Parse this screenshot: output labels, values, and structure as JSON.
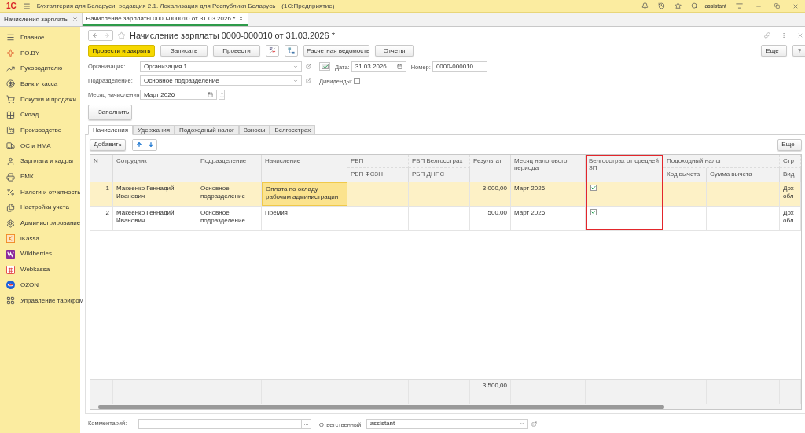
{
  "app": {
    "logo": "1С",
    "title": "Бухгалтерия для Беларуси, редакция 2.1. Локализация для Республики Беларусь",
    "platform": "(1С:Предприятие)",
    "user": "assistant"
  },
  "open_tabs": [
    {
      "label": "Начисления зарплаты",
      "selected": false
    },
    {
      "label": "Начисление зарплаты 0000-000010 от 31.03.2026 *",
      "selected": true
    }
  ],
  "sidebar": [
    {
      "label": "Главное",
      "kind": "menu"
    },
    {
      "label": "РО.BY",
      "kind": "ro"
    },
    {
      "label": "Руководителю",
      "kind": "trend"
    },
    {
      "label": "Банк и касса",
      "kind": "coin"
    },
    {
      "label": "Покупки и продажи",
      "kind": "cart"
    },
    {
      "label": "Склад",
      "kind": "grid"
    },
    {
      "label": "Производство",
      "kind": "factory"
    },
    {
      "label": "ОС и НМА",
      "kind": "truck"
    },
    {
      "label": "Зарплата и кадры",
      "kind": "person"
    },
    {
      "label": "РМК",
      "kind": "register"
    },
    {
      "label": "Налоги и отчетность",
      "kind": "percent"
    },
    {
      "label": "Настройки учета",
      "kind": "files"
    },
    {
      "label": "Администрирование",
      "kind": "gear"
    },
    {
      "label": "iKassa",
      "kind": "ikassa"
    },
    {
      "label": "Wildberries",
      "kind": "wb"
    },
    {
      "label": "Webkassa",
      "kind": "webkassa"
    },
    {
      "label": "OZON",
      "kind": "ozon"
    },
    {
      "label": "Управление тарифом",
      "kind": "tariff"
    }
  ],
  "document": {
    "title": "Начисление зарплаты 0000-000010 от 31.03.2026 *"
  },
  "toolbar": [
    {
      "label": "Провести и закрыть",
      "kind": "primary"
    },
    {
      "label": "Записать",
      "kind": "plain"
    },
    {
      "label": "Провести",
      "kind": "plain"
    },
    {
      "kind": "dtkt"
    },
    {
      "kind": "structure"
    },
    {
      "label": "Расчетная ведомость",
      "kind": "print"
    },
    {
      "label": "Отчеты",
      "kind": "dropdown"
    }
  ],
  "more_button": "Еще",
  "help_button": "?",
  "fields": {
    "organization": {
      "label": "Организация:",
      "value": "Организация 1"
    },
    "date": {
      "label": "Дата:",
      "value": "31.03.2026"
    },
    "number": {
      "label": "Номер:",
      "value": "0000-000010"
    },
    "department": {
      "label": "Подразделение:",
      "value": "Основное подразделение"
    },
    "dividends": {
      "label": "Дивиденды:",
      "checked": false
    },
    "month": {
      "label": "Месяц начисления:",
      "value": "Март 2026"
    }
  },
  "fill_button": "Заполнить",
  "tabs": [
    {
      "label": "Начисления",
      "selected": true
    },
    {
      "label": "Удержания",
      "selected": false
    },
    {
      "label": "Подоходный налог",
      "selected": false
    },
    {
      "label": "Взносы",
      "selected": false
    },
    {
      "label": "Белгосстрах",
      "selected": false
    }
  ],
  "table_toolbar": {
    "add": "Добавить",
    "more": "Еще"
  },
  "table": {
    "columns": [
      {
        "kind": "single",
        "title": "N"
      },
      {
        "kind": "single",
        "title": "Сотрудник"
      },
      {
        "kind": "single",
        "title": "Подразделение"
      },
      {
        "kind": "single",
        "title": "Начисление"
      },
      {
        "kind": "double",
        "title": "РБП",
        "subtitle": "РБП ФСЗН"
      },
      {
        "kind": "double",
        "title": "РБП Белгосстрах",
        "subtitle": "РБП ДНПС"
      },
      {
        "kind": "single",
        "title": "Результат"
      },
      {
        "kind": "single",
        "title": "Месяц налогового периода"
      },
      {
        "kind": "single",
        "title": "Белгосстрах от средней ЗП",
        "highlighted": true
      },
      {
        "kind": "group",
        "title": "Подоходный налог",
        "subtitles": [
          "Код вычета",
          "Сумма вычета"
        ]
      },
      {
        "kind": "double",
        "title": "Стр",
        "subtitle": "Вид"
      }
    ],
    "rows": [
      {
        "selected": true,
        "n": "1",
        "employee": "Макеенко Геннадий Иванович",
        "department": "Основное подразделение",
        "accrual": "Оплата по окладу рабочим администрации",
        "result": "3 000,00",
        "month": "Март 2026",
        "avg_salary": true,
        "column_12": "Дох обл"
      },
      {
        "selected": false,
        "n": "2",
        "employee": "Макеенко Геннадий Иванович",
        "department": "Основное подразделение",
        "accrual": "Премия",
        "result": "500,00",
        "month": "Март 2026",
        "avg_salary": true,
        "column_12": "Дох обл"
      }
    ],
    "total_result": "3 500,00"
  },
  "footer": {
    "comment_label": "Комментарий:",
    "choose_button": "...",
    "responsible_label": "Ответственный:",
    "responsible": "assistant"
  }
}
